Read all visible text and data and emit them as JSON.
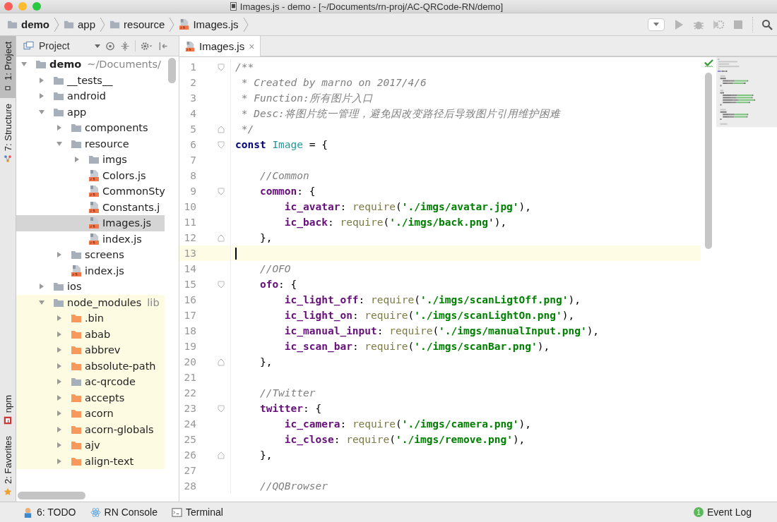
{
  "window": {
    "title": "Images.js - demo - [~/Documents/rn-proj/AC-QRCode-RN/demo]"
  },
  "breadcrumbs": [
    {
      "label": "demo",
      "kind": "folder",
      "bold": true
    },
    {
      "label": "app",
      "kind": "folder",
      "bold": false
    },
    {
      "label": "resource",
      "kind": "folder",
      "bold": false
    },
    {
      "label": "Images.js",
      "kind": "js",
      "bold": false
    }
  ],
  "tool_strip": [
    {
      "label": "1: Project",
      "kind": "project",
      "selected": true
    },
    {
      "label": "7: Structure",
      "kind": "structure",
      "selected": false
    },
    {
      "label": "npm",
      "kind": "npm",
      "selected": false
    },
    {
      "label": "2: Favorites",
      "kind": "favorites",
      "selected": false
    }
  ],
  "project_panel": {
    "title": "Project",
    "tree": [
      {
        "label": "demo",
        "hint": "~/Documents/",
        "kind": "folder",
        "bold": true,
        "expanded": true,
        "children": [
          {
            "label": "__tests__",
            "kind": "folder",
            "expanded": false
          },
          {
            "label": "android",
            "kind": "folder",
            "expanded": false
          },
          {
            "label": "app",
            "kind": "folder",
            "expanded": true,
            "children": [
              {
                "label": "components",
                "kind": "folder",
                "expanded": false
              },
              {
                "label": "resource",
                "kind": "folder",
                "expanded": true,
                "children": [
                  {
                    "label": "imgs",
                    "kind": "folder",
                    "expanded": false
                  },
                  {
                    "label": "Colors.js",
                    "kind": "js",
                    "selected": false
                  },
                  {
                    "label": "CommonSty",
                    "kind": "js",
                    "selected": false
                  },
                  {
                    "label": "Constants.j",
                    "kind": "js",
                    "selected": false
                  },
                  {
                    "label": "Images.js",
                    "kind": "js",
                    "selected": true
                  },
                  {
                    "label": "index.js",
                    "kind": "js",
                    "selected": false
                  }
                ]
              },
              {
                "label": "screens",
                "kind": "folder",
                "expanded": false
              },
              {
                "label": "index.js",
                "kind": "js",
                "selected": false
              }
            ]
          },
          {
            "label": "ios",
            "kind": "folder",
            "expanded": false
          },
          {
            "label": "node_modules",
            "hint": "lib",
            "kind": "folder",
            "library": true,
            "expanded": true,
            "children": [
              {
                "label": ".bin",
                "kind": "package",
                "expanded": false
              },
              {
                "label": "abab",
                "kind": "package",
                "expanded": false
              },
              {
                "label": "abbrev",
                "kind": "package",
                "expanded": false
              },
              {
                "label": "absolute-path",
                "kind": "package",
                "expanded": false
              },
              {
                "label": "ac-qrcode",
                "kind": "folder",
                "expanded": false
              },
              {
                "label": "accepts",
                "kind": "package",
                "expanded": false
              },
              {
                "label": "acorn",
                "kind": "package",
                "expanded": false
              },
              {
                "label": "acorn-globals",
                "kind": "package",
                "expanded": false
              },
              {
                "label": "ajv",
                "kind": "package",
                "expanded": false
              },
              {
                "label": "align-text",
                "kind": "package",
                "expanded": false
              }
            ]
          }
        ]
      }
    ]
  },
  "editor": {
    "tabs": [
      {
        "label": "Images.js",
        "close": "×",
        "selected": true
      }
    ],
    "lines": [
      {
        "number": "1",
        "kind": "fold-start",
        "segments": [
          {
            "kind": "comment",
            "text": "/**"
          }
        ]
      },
      {
        "number": "2",
        "segments": [
          {
            "kind": "comment",
            "text": " * Created by marno on 2017/4/6"
          }
        ]
      },
      {
        "number": "3",
        "segments": [
          {
            "kind": "comment",
            "text": " * Function:所有图片入口"
          }
        ]
      },
      {
        "number": "4",
        "segments": [
          {
            "kind": "comment",
            "text": " * Desc:将图片统一管理，避免因改变路径后导致图片引用维护困难"
          }
        ]
      },
      {
        "number": "5",
        "kind": "fold-end",
        "segments": [
          {
            "kind": "comment",
            "text": " */"
          }
        ]
      },
      {
        "number": "6",
        "kind": "fold-start",
        "segments": [
          {
            "kind": "keyword",
            "text": "const"
          },
          {
            "kind": "class",
            "text": " Image"
          },
          {
            "kind": "punct",
            "text": " = {"
          }
        ]
      },
      {
        "number": "7"
      },
      {
        "number": "8",
        "segments": [
          {
            "kind": "comment",
            "text": "    //Common"
          }
        ]
      },
      {
        "number": "9",
        "kind": "fold-start",
        "segments": [
          {
            "kind": "property",
            "text": "    common"
          },
          {
            "kind": "punct",
            "text": ": {"
          }
        ]
      },
      {
        "number": "10",
        "segments": [
          {
            "kind": "property",
            "text": "        ic_avatar"
          },
          {
            "kind": "punct",
            "text": ": "
          },
          {
            "kind": "call",
            "text": "require"
          },
          {
            "kind": "punct",
            "text": "("
          },
          {
            "kind": "string",
            "text": "'./imgs/avatar.jpg'"
          },
          {
            "kind": "punct",
            "text": "),"
          }
        ]
      },
      {
        "number": "11",
        "segments": [
          {
            "kind": "property",
            "text": "        ic_back"
          },
          {
            "kind": "punct",
            "text": ": "
          },
          {
            "kind": "call",
            "text": "require"
          },
          {
            "kind": "punct",
            "text": "("
          },
          {
            "kind": "string",
            "text": "'./imgs/back.png"
          },
          {
            "kind": "punct",
            "text": "'),"
          }
        ]
      },
      {
        "number": "12",
        "kind": "fold-end",
        "segments": [
          {
            "kind": "punct",
            "text": "    },"
          }
        ]
      },
      {
        "number": "13",
        "current": true
      },
      {
        "number": "14",
        "segments": [
          {
            "kind": "comment",
            "text": "    //OFO"
          }
        ]
      },
      {
        "number": "15",
        "kind": "fold-start",
        "segments": [
          {
            "kind": "property",
            "text": "    ofo"
          },
          {
            "kind": "punct",
            "text": ": {"
          }
        ]
      },
      {
        "number": "16",
        "segments": [
          {
            "kind": "property",
            "text": "        ic_light_off"
          },
          {
            "kind": "punct",
            "text": ": "
          },
          {
            "kind": "call",
            "text": "require"
          },
          {
            "kind": "punct",
            "text": "("
          },
          {
            "kind": "string",
            "text": "'./imgs/scanLigtOff.png'"
          },
          {
            "kind": "punct",
            "text": "),"
          }
        ]
      },
      {
        "number": "17",
        "segments": [
          {
            "kind": "property",
            "text": "        ic_light_on"
          },
          {
            "kind": "punct",
            "text": ": "
          },
          {
            "kind": "call",
            "text": "require"
          },
          {
            "kind": "punct",
            "text": "("
          },
          {
            "kind": "string",
            "text": "'./imgs/scanLightOn.png'"
          },
          {
            "kind": "punct",
            "text": "),"
          }
        ]
      },
      {
        "number": "18",
        "segments": [
          {
            "kind": "property",
            "text": "        ic_manual_input"
          },
          {
            "kind": "punct",
            "text": ": "
          },
          {
            "kind": "call",
            "text": "require"
          },
          {
            "kind": "punct",
            "text": "("
          },
          {
            "kind": "string",
            "text": "'./imgs/manualInput.png'"
          },
          {
            "kind": "punct",
            "text": "),"
          }
        ]
      },
      {
        "number": "19",
        "segments": [
          {
            "kind": "property",
            "text": "        ic_scan_bar"
          },
          {
            "kind": "punct",
            "text": ": "
          },
          {
            "kind": "call",
            "text": "require"
          },
          {
            "kind": "punct",
            "text": "("
          },
          {
            "kind": "string",
            "text": "'./imgs/scanBar.png'"
          },
          {
            "kind": "punct",
            "text": "),"
          }
        ]
      },
      {
        "number": "20",
        "kind": "fold-end",
        "segments": [
          {
            "kind": "punct",
            "text": "    },"
          }
        ]
      },
      {
        "number": "21"
      },
      {
        "number": "22",
        "segments": [
          {
            "kind": "comment",
            "text": "    //Twitter"
          }
        ]
      },
      {
        "number": "23",
        "kind": "fold-start",
        "segments": [
          {
            "kind": "property",
            "text": "    twitter"
          },
          {
            "kind": "punct",
            "text": ": {"
          }
        ]
      },
      {
        "number": "24",
        "segments": [
          {
            "kind": "property",
            "text": "        ic_camera"
          },
          {
            "kind": "punct",
            "text": ": "
          },
          {
            "kind": "call",
            "text": "require"
          },
          {
            "kind": "punct",
            "text": "("
          },
          {
            "kind": "string",
            "text": "'./imgs/camera.png'"
          },
          {
            "kind": "punct",
            "text": "),"
          }
        ]
      },
      {
        "number": "25",
        "segments": [
          {
            "kind": "property",
            "text": "        ic_close"
          },
          {
            "kind": "punct",
            "text": ": "
          },
          {
            "kind": "call",
            "text": "require"
          },
          {
            "kind": "punct",
            "text": "("
          },
          {
            "kind": "string",
            "text": "'./imgs/remove.png'"
          },
          {
            "kind": "punct",
            "text": "),"
          }
        ]
      },
      {
        "number": "26",
        "kind": "fold-end",
        "segments": [
          {
            "kind": "punct",
            "text": "    },"
          }
        ]
      },
      {
        "number": "27"
      },
      {
        "number": "28",
        "segments": [
          {
            "kind": "comment",
            "text": "    //QQBrowser"
          }
        ]
      }
    ]
  },
  "status_bar": {
    "items": [
      {
        "label": "6: TODO",
        "kind": "todo"
      },
      {
        "label": "RN Console",
        "kind": "react"
      },
      {
        "label": "Terminal",
        "kind": "terminal"
      }
    ],
    "event_log": {
      "label": "Event Log",
      "count": "1"
    }
  }
}
